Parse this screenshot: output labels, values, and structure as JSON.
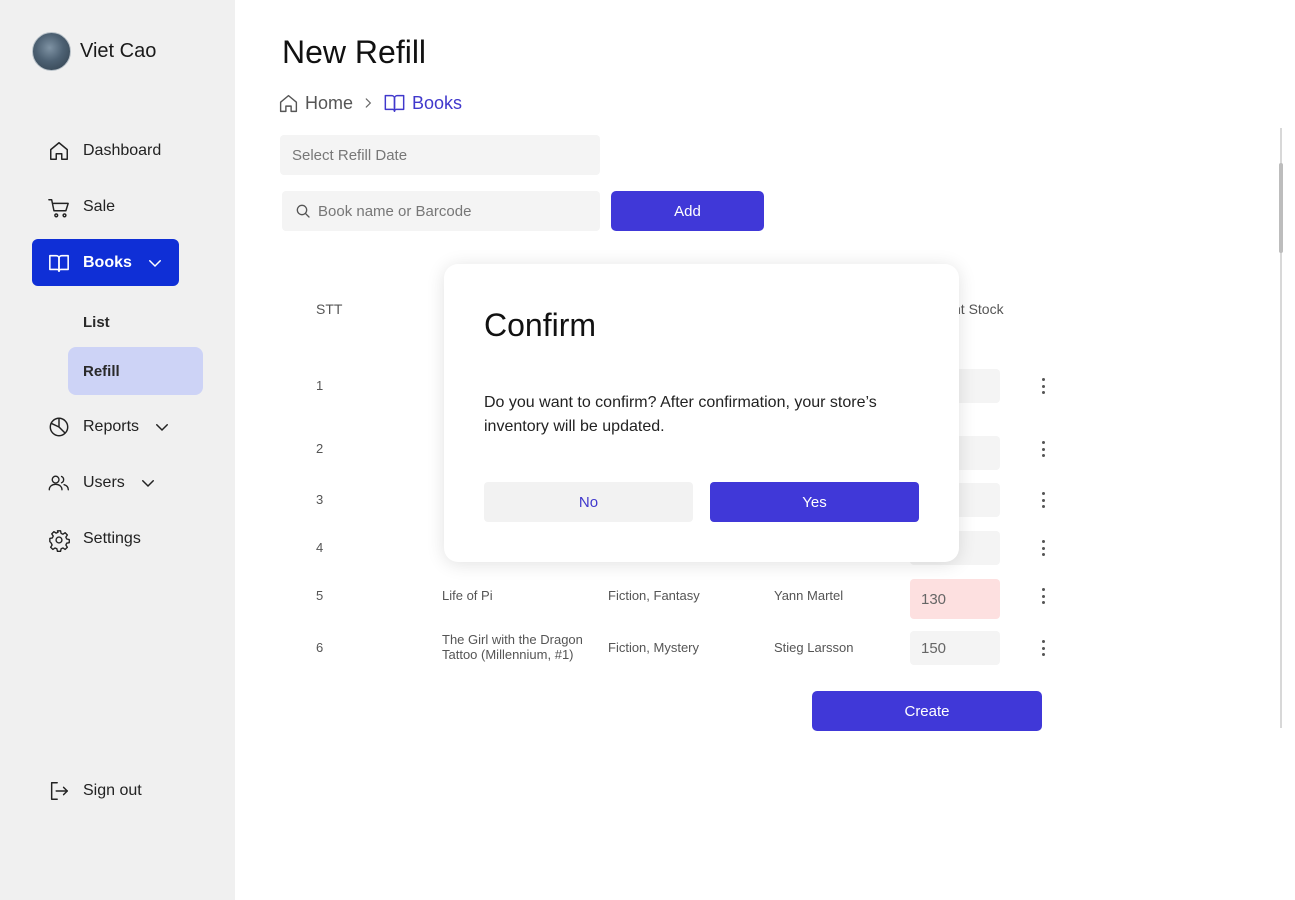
{
  "user": {
    "name": "Viet Cao"
  },
  "nav": {
    "dashboard": "Dashboard",
    "sale": "Sale",
    "books": "Books",
    "books_sub": {
      "list": "List",
      "refill": "Refill"
    },
    "reports": "Reports",
    "users": "Users",
    "settings": "Settings",
    "sign_out": "Sign out"
  },
  "page": {
    "title": "New Refill",
    "breadcrumb": {
      "home": "Home",
      "current": "Books"
    }
  },
  "form": {
    "date_placeholder": "Select Refill Date",
    "search_placeholder": "Book name or Barcode",
    "add_label": "Add"
  },
  "table": {
    "headers": {
      "stt": "STT",
      "stock_partial": "nt Stock"
    },
    "rows": [
      {
        "stt": "1",
        "stock": ""
      },
      {
        "stt": "2",
        "stock": ""
      },
      {
        "stt": "3",
        "stock": ""
      },
      {
        "stt": "4",
        "stock": ""
      },
      {
        "stt": "5",
        "name": "Life of Pi",
        "genre": "Fiction, Fantasy",
        "author": "Yann Martel",
        "stock": "130"
      },
      {
        "stt": "6",
        "name": "The Girl with the Dragon Tattoo (Millennium, #1)",
        "genre": "Fiction, Mystery",
        "author": "Stieg Larsson",
        "stock": "150"
      }
    ],
    "create_label": "Create"
  },
  "modal": {
    "title": "Confirm",
    "body": "Do you want to confirm? After confirmation, your store’s inventory will be updated.",
    "no_label": "No",
    "yes_label": "Yes"
  },
  "colors": {
    "primary": "#4038d8",
    "nav_active": "#0f2fd6",
    "sub_active": "#cdd3f6",
    "stock_warning": "#fde0e0"
  }
}
